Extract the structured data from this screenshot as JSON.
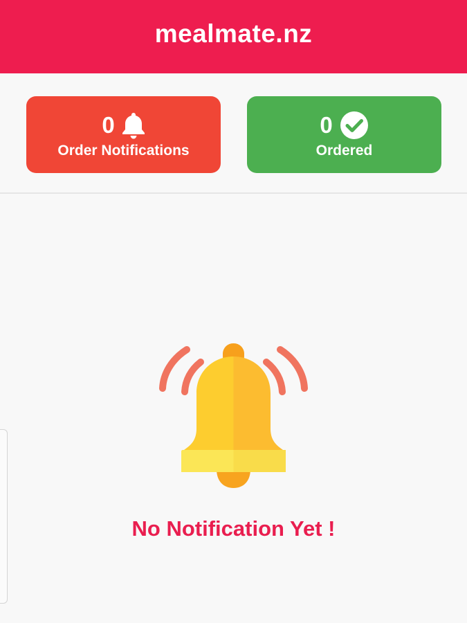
{
  "header": {
    "title": "mealmate.nz",
    "color": "#ee1d4f"
  },
  "stats": {
    "order_notifications": {
      "count": "0",
      "label": "Order Notifications",
      "icon": "bell-icon",
      "color": "#f04636"
    },
    "ordered": {
      "count": "0",
      "label": "Ordered",
      "icon": "check-circle-icon",
      "color": "#4caf50"
    }
  },
  "empty_state": {
    "message": "No Notification Yet !",
    "icon": "ringing-bell-illustration",
    "text_color": "#e91e4f"
  }
}
